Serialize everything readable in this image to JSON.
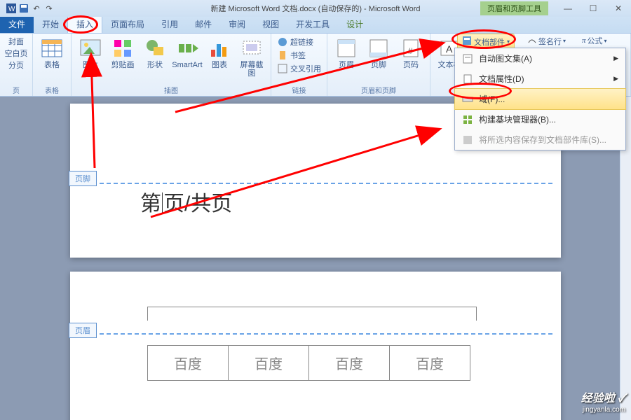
{
  "title": "新建 Microsoft Word 文档.docx (自动保存的) - Microsoft Word",
  "contextual_title": "页眉和页脚工具",
  "tabs": {
    "file": "文件",
    "home": "开始",
    "insert": "插入",
    "layout": "页面布局",
    "ref": "引用",
    "mail": "邮件",
    "review": "审阅",
    "view": "视图",
    "dev": "开发工具",
    "design": "设计"
  },
  "ribbon": {
    "cover": "封面",
    "blank": "空白页",
    "pagebreak": "分页",
    "group_pages": "页",
    "table": "表格",
    "group_tables": "表格",
    "picture": "图片",
    "clipart": "剪贴画",
    "shapes": "形状",
    "smartart": "SmartArt",
    "chart": "图表",
    "screenshot": "屏幕截图",
    "group_illust": "插图",
    "hyperlink": "超链接",
    "bookmark": "书签",
    "crossref": "交叉引用",
    "group_links": "链接",
    "header": "页眉",
    "footer": "页脚",
    "pagenum": "页码",
    "group_hf": "页眉和页脚",
    "textbox": "文本框",
    "quickparts": "文档部件",
    "signature": "签名行",
    "equation": "公式"
  },
  "dropdown": {
    "autotext": "自动图文集(A)",
    "docprop": "文档属性(D)",
    "field": "域(F)...",
    "bbmgr": "构建基块管理器(B)...",
    "save": "将所选内容保存到文档部件库(S)..."
  },
  "doc": {
    "footer_label": "页脚",
    "header_label": "页眉",
    "page_text_1": "第",
    "page_text_2": "页/共页",
    "cell": "百度"
  },
  "watermark": {
    "line1": "经验啦 ✓",
    "line2": "jingyanla.com"
  }
}
